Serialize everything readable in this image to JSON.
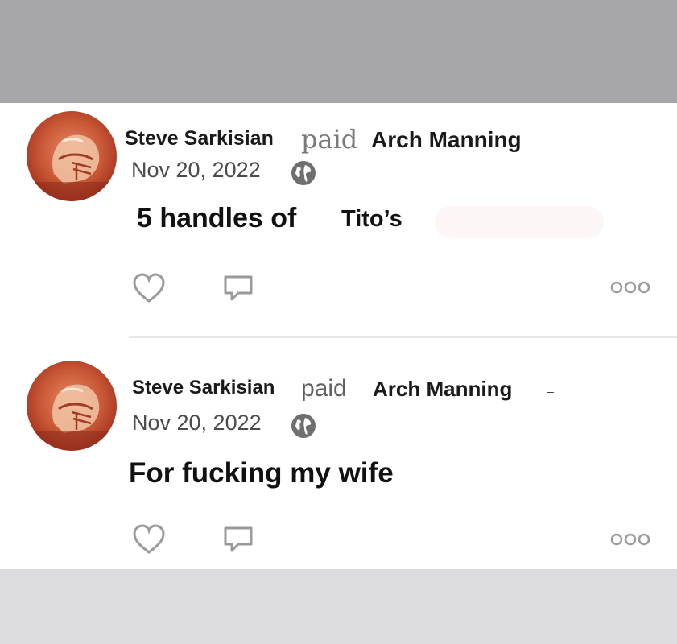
{
  "posts": [
    {
      "author": "Steve Sarkisian",
      "action": "paid",
      "recipient": "Arch Manning",
      "date": "Nov 20, 2022",
      "message_main": "5 handles of",
      "message_extra": "Tito’s"
    },
    {
      "author": "Steve Sarkisian",
      "action": "paid",
      "recipient": "Arch Manning",
      "date": "Nov 20, 2022",
      "message_main": "For fucking my wife",
      "message_extra": ""
    }
  ],
  "icons": {
    "globe": "globe-icon",
    "like": "heart-icon",
    "comment": "comment-icon",
    "more": "more-options-icon"
  },
  "colors": {
    "top_bar": "#a7a6a8",
    "bottom_bar": "#dcdbdd",
    "text": "#1a1a1a",
    "date": "#4b4b4b",
    "icon": "#9a9a9a",
    "avatar_bg": "#c0502e"
  }
}
